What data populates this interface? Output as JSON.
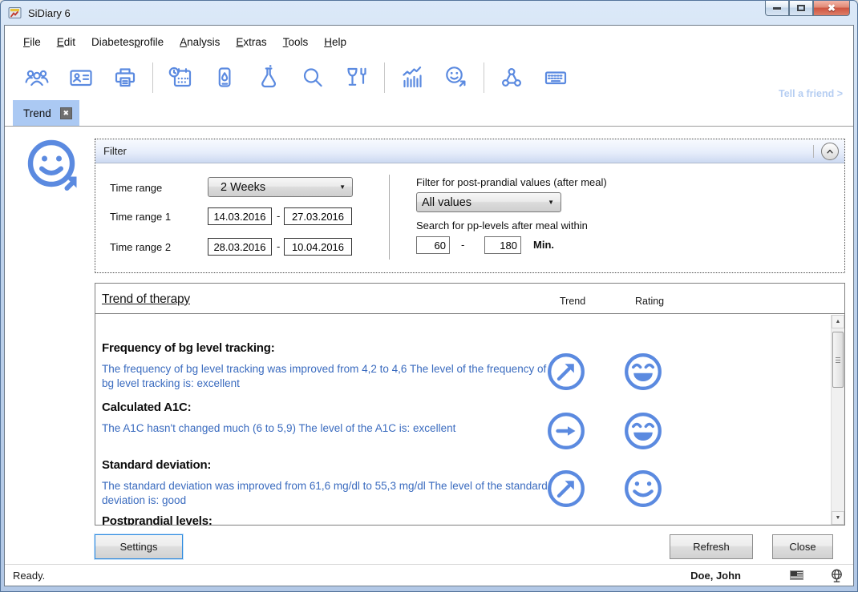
{
  "window": {
    "title": "SiDiary 6",
    "controls": [
      "minimize",
      "maximize",
      "close"
    ]
  },
  "menu": {
    "items": [
      {
        "pre": "",
        "key": "F",
        "post": "ile"
      },
      {
        "pre": "",
        "key": "E",
        "post": "dit"
      },
      {
        "pre": "Diabetes",
        "key": "p",
        "post": "rofile"
      },
      {
        "pre": "",
        "key": "A",
        "post": "nalysis"
      },
      {
        "pre": "",
        "key": "E",
        "post": "xtras"
      },
      {
        "pre": "",
        "key": "T",
        "post": "ools"
      },
      {
        "pre": "",
        "key": "H",
        "post": "elp"
      }
    ]
  },
  "toolbar": {
    "icons": [
      "users-icon",
      "contact-card-icon",
      "printer-icon",
      "calendar-clock-icon",
      "glucose-meter-icon",
      "lab-flask-icon",
      "search-icon",
      "nutrition-icon",
      "statistics-icon",
      "trend-smiley-icon",
      "share-icon",
      "keyboard-icon"
    ],
    "tell_a_friend": "Tell a friend >"
  },
  "tabs": [
    {
      "label": "Trend"
    }
  ],
  "filter": {
    "title": "Filter",
    "time_range_label": "Time range",
    "time_range_value": "2 Weeks",
    "time_range1_label": "Time range 1",
    "time_range1_from": "14.03.2016",
    "time_range1_to": "27.03.2016",
    "time_range2_label": "Time range 2",
    "time_range2_from": "28.03.2016",
    "time_range2_to": "10.04.2016",
    "range_separator": "-",
    "pp_filter_label": "Filter for post-prandial values (after meal)",
    "pp_filter_value": "All values",
    "pp_search_label": "Search for pp-levels after meal within",
    "pp_min": "60",
    "pp_max": "180",
    "pp_unit": "Min."
  },
  "trend_table": {
    "title": "Trend of therapy",
    "col_trend": "Trend",
    "col_rating": "Rating",
    "rows": [
      {
        "title": "Frequency of bg level tracking:",
        "description": "The frequency of bg level tracking was improved from 4,2 to 4,6 The level of the frequency of bg level tracking is: excellent",
        "trend": "up-right",
        "rating": "laugh"
      },
      {
        "title": "Calculated A1C:",
        "description": "The A1C hasn't changed much (6 to 5,9) The level of the A1C is: excellent",
        "trend": "right",
        "rating": "laugh"
      },
      {
        "title": "Standard deviation:",
        "description": "The standard deviation was improved from 61,6 mg/dl to 55,3 mg/dl The level of the standard deviation is: good",
        "trend": "up-right",
        "rating": "smile"
      },
      {
        "title": "Postprandial levels:",
        "description": "",
        "trend": "",
        "rating": ""
      }
    ]
  },
  "buttons": {
    "settings": "Settings",
    "refresh": "Refresh",
    "close": "Close"
  },
  "statusbar": {
    "status": "Ready.",
    "user": "Doe, John"
  },
  "colors": {
    "accent_blue": "#5b8ae0",
    "text_blue": "#3a6bbf",
    "tab_bg": "#abc9f3",
    "tell_a_friend": "#b6cef2"
  }
}
